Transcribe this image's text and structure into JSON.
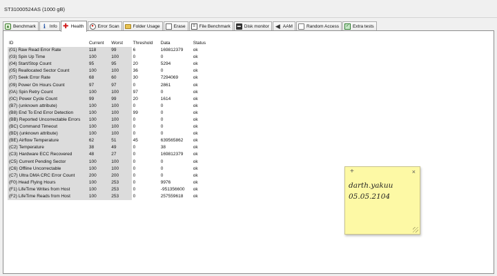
{
  "device": {
    "label": "ST31000524AS (1000 gB)"
  },
  "tabs": [
    {
      "label": "Benchmark",
      "icon": "benchmark-icon"
    },
    {
      "label": "Info",
      "icon": "info-icon"
    },
    {
      "label": "Health",
      "icon": "health-cross-icon",
      "active": true
    },
    {
      "label": "Error Scan",
      "icon": "error-scan-icon"
    },
    {
      "label": "Folder Usage",
      "icon": "folder-icon"
    },
    {
      "label": "Erase",
      "icon": "erase-icon"
    },
    {
      "label": "File Benchmark",
      "icon": "file-benchmark-icon"
    },
    {
      "label": "Disk monitor",
      "icon": "disk-monitor-icon"
    },
    {
      "label": "AAM",
      "icon": "speaker-icon"
    },
    {
      "label": "Random Access",
      "icon": "random-access-icon"
    },
    {
      "label": "Extra tests",
      "icon": "extra-tests-icon"
    }
  ],
  "table": {
    "headers": {
      "id": "ID",
      "current": "Current",
      "worst": "Worst",
      "threshold": "Threshold",
      "data": "Data",
      "status": "Status"
    },
    "rows": [
      [
        "(01) Raw Read Error Rate",
        "118",
        "99",
        "6",
        "169812379",
        "ok"
      ],
      [
        "(03) Spin Up Time",
        "100",
        "100",
        "0",
        "0",
        "ok"
      ],
      [
        "(04) Start/Stop Count",
        "95",
        "95",
        "20",
        "5294",
        "ok"
      ],
      [
        "(05) Reallocated Sector Count",
        "100",
        "100",
        "36",
        "0",
        "ok"
      ],
      [
        "(07) Seek Error Rate",
        "68",
        "60",
        "30",
        "7294069",
        "ok"
      ],
      [
        "(09) Power On Hours Count",
        "97",
        "97",
        "0",
        "2861",
        "ok"
      ],
      [
        "(0A) Spin Retry Count",
        "100",
        "100",
        "97",
        "0",
        "ok"
      ],
      [
        "(0C) Power Cycle Count",
        "99",
        "99",
        "20",
        "1614",
        "ok"
      ],
      [
        "(B7) (unknown attribute)",
        "100",
        "100",
        "0",
        "0",
        "ok"
      ],
      [
        "(B8) End To End Error Detection",
        "100",
        "100",
        "99",
        "0",
        "ok"
      ],
      [
        "(BB) Reported Uncorrectable Errors",
        "100",
        "100",
        "0",
        "0",
        "ok"
      ],
      [
        "(BC) Command Timeout",
        "100",
        "100",
        "0",
        "0",
        "ok"
      ],
      [
        "(BD) (unknown attribute)",
        "100",
        "100",
        "0",
        "0",
        "ok"
      ],
      [
        "(BE) Airflow Temperature",
        "62",
        "51",
        "45",
        "639565862",
        "ok"
      ],
      [
        "(C2) Temperature",
        "38",
        "49",
        "0",
        "38",
        "ok"
      ],
      [
        "(C3) Hardware ECC Recovered",
        "48",
        "27",
        "0",
        "169812379",
        "ok"
      ],
      [
        "(C5) Current Pending Sector",
        "100",
        "100",
        "0",
        "0",
        "ok"
      ],
      [
        "(C6) Offline Uncorrectable",
        "100",
        "100",
        "0",
        "0",
        "ok"
      ],
      [
        "(C7) Ultra DMA CRC Error Count",
        "200",
        "200",
        "0",
        "0",
        "ok"
      ],
      [
        "(F0) Head Flying Hours",
        "100",
        "253",
        "0",
        "9976",
        "ok"
      ],
      [
        "(F1) LifeTime Writes from Host",
        "100",
        "253",
        "0",
        "-951356600",
        "ok"
      ],
      [
        "(F2) LifeTime Reads from Host",
        "100",
        "253",
        "0",
        "257559618",
        "ok"
      ]
    ]
  },
  "note": {
    "add_glyph": "+",
    "close_glyph": "×",
    "line1": "darth.yakuu",
    "line2": "05.05.2104",
    "color": "#fdf9a5"
  }
}
